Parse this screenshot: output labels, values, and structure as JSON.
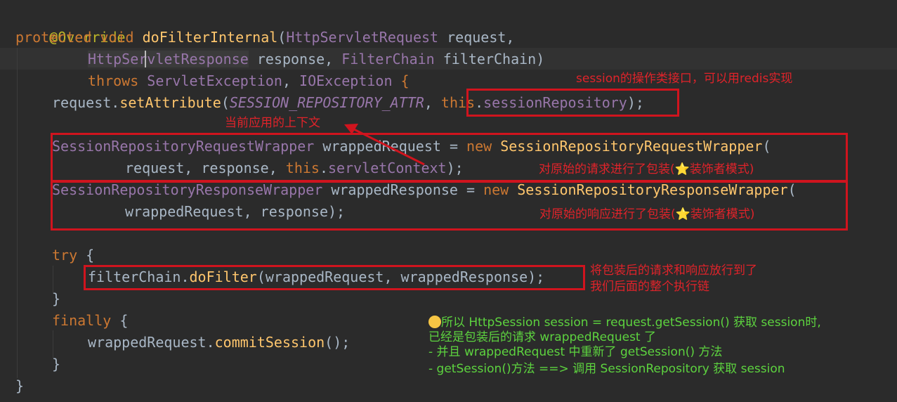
{
  "code": {
    "l1_annotation": "@Override",
    "l2_protected": "protected",
    "l2_void": "void",
    "l2_method": "doFilterInternal",
    "l2_paren": "(",
    "l2_type": "HttpServletRequest",
    "l2_param": " request,",
    "l3_type_a": "HttpSe",
    "l3_type_b": "rvletResponse",
    "l3_param": " response, ",
    "l3_type2": "FilterChain",
    "l3_param2": " filterChain)",
    "l4_throws": "throws",
    "l4_ex1": "ServletException",
    "l4_comma": ", ",
    "l4_ex2": "IOException",
    "l4_brace": " {",
    "l5_obj": "request.",
    "l5_method": "setAttribute",
    "l5_paren": "(",
    "l5_const": "SESSION_REPOSITORY_ATTR",
    "l5_comma": ", ",
    "l5_this": "this",
    "l5_dot": ".",
    "l5_field": "sessionRepository",
    "l5_end": ");",
    "l6_type": "SessionRepositoryRequestWrapper",
    "l6_var": " wrappedRequest = ",
    "l6_new": "new",
    "l6_cls": " SessionRepositoryRequestWrapper",
    "l6_paren": "(",
    "l7_args": "request, response, ",
    "l7_this": "this",
    "l7_dot": ".",
    "l7_field": "servletContext",
    "l7_end": ");",
    "l8_type": "SessionRepositoryResponseWrapper",
    "l8_var": " wrappedResponse = ",
    "l8_new": "new",
    "l8_cls": " SessionRepositoryResponseWrapper",
    "l8_paren": "(",
    "l9_args": "wrappedRequest, response);",
    "l10_try": "try",
    "l10_brace": " {",
    "l11_obj": "filterChain.",
    "l11_method": "doFilter",
    "l11_args": "(wrappedRequest, wrappedResponse);",
    "l12_brace": "}",
    "l13_finally": "finally",
    "l13_brace": " {",
    "l14_obj": "wrappedRequest.",
    "l14_method": "commitSession",
    "l14_end": "();",
    "l15_brace": "}",
    "l16_brace": "}"
  },
  "notes": {
    "repo": "session的操作类接口，可以用redis实现",
    "context": "当前应用的上下文",
    "request_wrap_a": "对原始的请求进行了包装(",
    "request_wrap_b": "装饰者模式)",
    "response_wrap_a": "对原始的响应进行了包装(",
    "response_wrap_b": "装饰者模式)",
    "filter_1": "将包装后的请求和响应放行到了",
    "filter_2": "我们后面的整个执行链",
    "summary_1": "所以 HttpSession session = request.getSession() 获取 session时,",
    "summary_2": "已经是包装后的请求 wrappedRequest 了",
    "summary_3": "- 并且 wrappedRequest 中重新了 getSession() 方法",
    "summary_4": "- getSession()方法 ==> 调用 SessionRepository 获取 session",
    "star": "⭐"
  },
  "colors": {
    "background": "#2b2b2b",
    "keyword": "#cc7832",
    "method": "#ffc66d",
    "field": "#9876aa",
    "annotation": "#bbb529",
    "text": "#a9b7c6",
    "highlight_box": "#d0141e",
    "note_red": "#e0232a",
    "note_green": "#5dd33f"
  },
  "icons": {
    "star": "star-icon",
    "thinking": "thinking-face-icon",
    "arrow": "arrow-icon"
  }
}
